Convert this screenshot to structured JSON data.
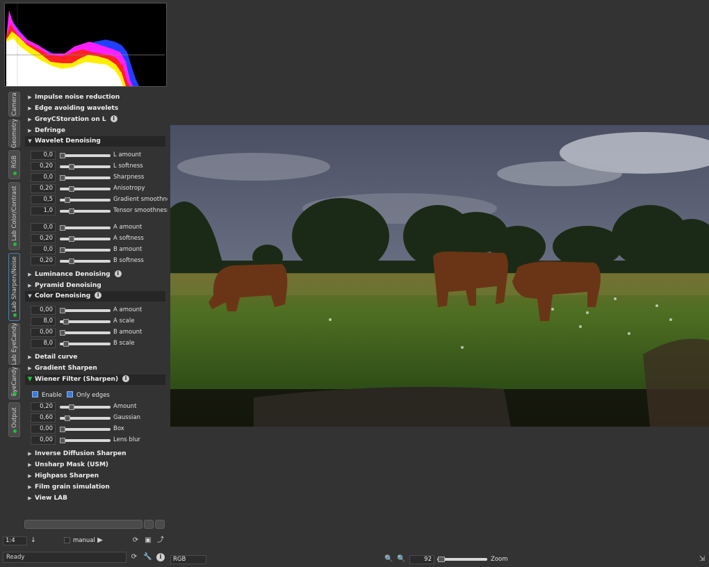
{
  "tabs": [
    {
      "label": "Camera",
      "active": false,
      "dot": false
    },
    {
      "label": "Geometry",
      "active": false,
      "dot": false
    },
    {
      "label": "RGB",
      "active": false,
      "dot": true
    },
    {
      "label": "Lab Color/Contrast",
      "active": false,
      "dot": true
    },
    {
      "label": "Lab Sharpen/Noise",
      "active": true,
      "dot": true
    },
    {
      "label": "Lab EyeCandy",
      "active": false,
      "dot": false
    },
    {
      "label": "EyeCandy",
      "active": false,
      "dot": true
    },
    {
      "label": "Output",
      "active": false,
      "dot": true
    }
  ],
  "sections": {
    "impulse": "Impulse noise reduction",
    "edge": "Edge avoiding wavelets",
    "greyc": "GreyCStoration on L",
    "defringe": "Defringe",
    "wavelet": "Wavelet Denoising",
    "luminance": "Luminance Denoising",
    "pyramid": "Pyramid Denoising",
    "color": "Color Denoising",
    "detail": "Detail curve",
    "gradient": "Gradient Sharpen",
    "wiener": "Wiener Filter (Sharpen)",
    "inverse": "Inverse Diffusion Sharpen",
    "usm": "Unsharp Mask (USM)",
    "highpass": "Highpass Sharpen",
    "grain": "Film grain simulation",
    "viewlab": "View LAB"
  },
  "wavelet_rows": [
    {
      "value": "0,0",
      "label": "L amount",
      "level": 0.0
    },
    {
      "value": "0,20",
      "label": "L softness",
      "level": 0.2
    },
    {
      "value": "0,0",
      "label": "Sharpness",
      "level": 0.0
    },
    {
      "value": "0,20",
      "label": "Anisotropy",
      "level": 0.2
    },
    {
      "value": "0,5",
      "label": "Gradient smoothness",
      "level": 0.1
    },
    {
      "value": "1,0",
      "label": "Tensor smoothness",
      "level": 0.2
    },
    {
      "value": "0,0",
      "label": "A amount",
      "level": 0.0
    },
    {
      "value": "0,20",
      "label": "A softness",
      "level": 0.2
    },
    {
      "value": "0,0",
      "label": "B amount",
      "level": 0.0
    },
    {
      "value": "0,20",
      "label": "B softness",
      "level": 0.2
    }
  ],
  "color_rows": [
    {
      "value": "0,00",
      "label": "A amount",
      "level": 0.0
    },
    {
      "value": "8,0",
      "label": "A scale",
      "level": 0.08
    },
    {
      "value": "0,00",
      "label": "B amount",
      "level": 0.0
    },
    {
      "value": "8,0",
      "label": "B scale",
      "level": 0.08
    }
  ],
  "wiener": {
    "enable_label": "Enable",
    "only_edges_label": "Only edges",
    "rows": [
      {
        "value": "0,20",
        "label": "Amount",
        "level": 0.2
      },
      {
        "value": "0,60",
        "label": "Gaussian",
        "level": 0.1
      },
      {
        "value": "0,00",
        "label": "Box",
        "level": 0.0
      },
      {
        "value": "0,00",
        "label": "Lens blur",
        "level": 0.0
      }
    ]
  },
  "bottom": {
    "zoom_ratio": "1:4",
    "manual_label": "manual",
    "status": "Ready",
    "color_mode": "RGB",
    "zoom_value": "92",
    "zoom_label": "Zoom"
  },
  "icons": {
    "play": "play-icon",
    "refresh": "refresh-icon",
    "save": "save-icon",
    "pin": "pin-icon",
    "zoom_in": "zoom-in-icon",
    "zoom_out": "zoom-out-icon",
    "info": "info-icon",
    "wrench": "wrench-icon"
  },
  "colors": {
    "background": "#333333",
    "panel_dark": "#262626",
    "accent": "#3a7bd5",
    "active_dot": "#1fbf3a"
  }
}
